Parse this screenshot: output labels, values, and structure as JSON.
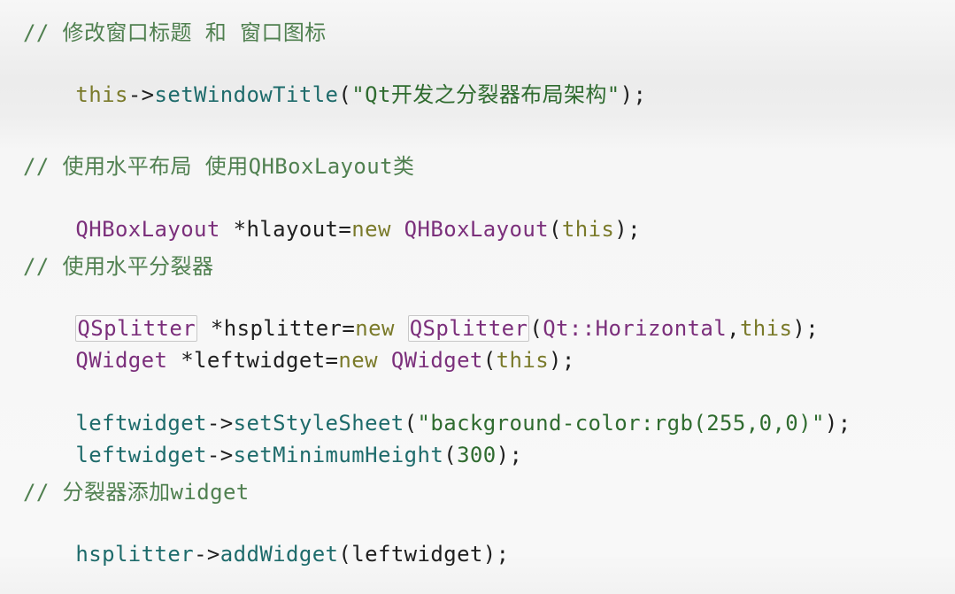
{
  "code": {
    "l1": {
      "comment": "// 修改窗口标题 和 窗口图标"
    },
    "l2": {
      "a": "this",
      "b": "->",
      "c": "setWindowTitle",
      "d": "(",
      "e": "\"Qt开发之分裂器布局架构\"",
      "f": ");"
    },
    "l3": {
      "comment": "// 使用水平布局 使用QHBoxLayout类"
    },
    "l4": {
      "a": "QHBoxLayout",
      "b": " *hlayout=",
      "c": "new",
      "d": " ",
      "e": "QHBoxLayout",
      "f": "(",
      "g": "this",
      "h": ");"
    },
    "l5": {
      "comment": "// 使用水平分裂器"
    },
    "l6": {
      "a": "QSplitter",
      "b": " *hsplitter=",
      "c": "new",
      "d": " ",
      "e": "QSplitter",
      "f": "(",
      "g": "Qt::Horizontal",
      "h": ",",
      "i": "this",
      "j": ");"
    },
    "l7": {
      "a": "QWidget",
      "b": " *leftwidget=",
      "c": "new",
      "d": " ",
      "e": "QWidget",
      "f": "(",
      "g": "this",
      "h": ");"
    },
    "l8": {
      "a": "leftwidget",
      "b": "->",
      "c": "setStyleSheet",
      "d": "(",
      "e": "\"background-color:rgb(255,0,0)\"",
      "f": ");"
    },
    "l9": {
      "a": "leftwidget",
      "b": "->",
      "c": "setMinimumHeight",
      "d": "(",
      "e": "300",
      "f": ");"
    },
    "l10": {
      "comment": "// 分裂器添加widget"
    },
    "l11": {
      "a": "hsplitter",
      "b": "->",
      "c": "addWidget",
      "d": "(",
      "e": "leftwidget",
      "f": ");"
    }
  }
}
